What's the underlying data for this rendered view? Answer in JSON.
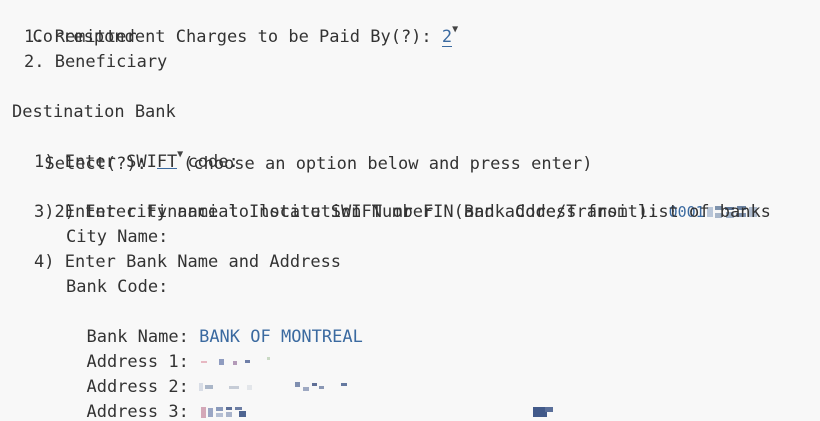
{
  "charges": {
    "prompt": "Correspondent Charges to be Paid By(?): ",
    "value": "2",
    "dropdown_icon": "triangle-down-icon",
    "options": [
      "1. Remitter",
      "2. Beneficiary"
    ]
  },
  "destination": {
    "heading": "Destination Bank",
    "select_prompt": "Select(?): ",
    "select_value": "__",
    "select_hint": "(choose an option below and press enter)",
    "option1": "1) Enter SWIFT code:",
    "option2": "2) Enter Financial Institution Number  (Bank Code/Transit): ",
    "option2_value": "0001",
    "option3": "3) Enter city name to locate SWIFT or FIN and address from list of banks",
    "city_label": "City Name:",
    "option4": "4) Enter Bank Name and Address",
    "bank_code_label": "Bank Code:",
    "bank_name_label": "Bank Name: ",
    "bank_name_value": "BANK OF MONTREAL",
    "address1_label": "Address 1: ",
    "address2_label": "Address 2: ",
    "address3_label": "Address 3: "
  },
  "colors": {
    "text": "#333333",
    "value": "#3b6aa0",
    "background": "#f8f8f8"
  }
}
